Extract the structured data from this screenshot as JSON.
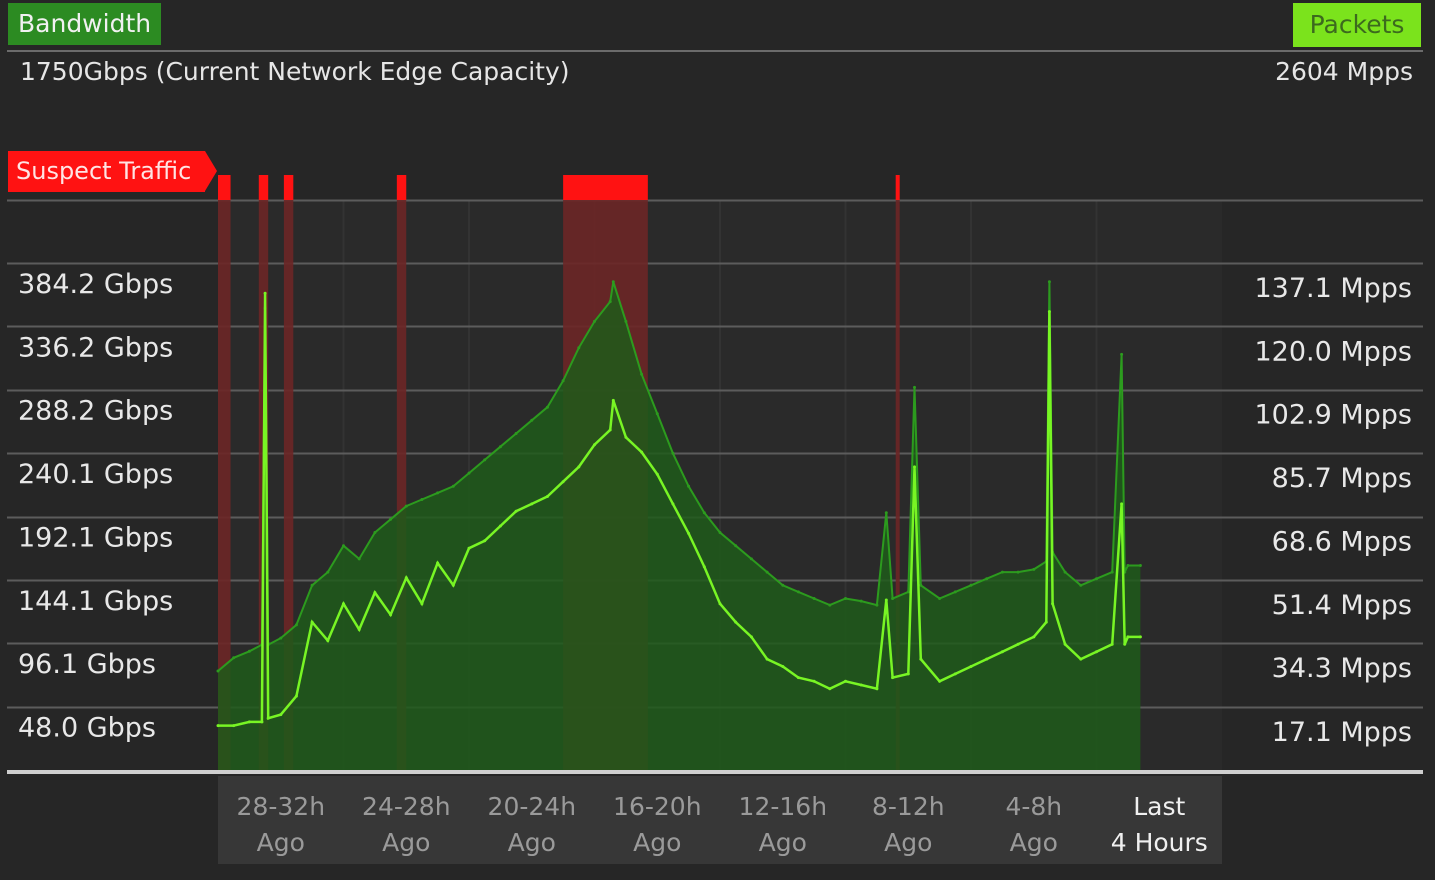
{
  "header": {
    "bandwidth_tab": "Bandwidth",
    "packets_tab": "Packets",
    "capacity_caption": "1750Gbps (Current Network Edge Capacity)",
    "packets_capacity": "2604 Mpps",
    "suspect_label": "Suspect Traffic"
  },
  "colors": {
    "background": "#262626",
    "bandwidth_tag": "#2c8b22",
    "packets_tag": "#7be31c",
    "suspect": "#ff1212",
    "suspect_band": "#6b2626",
    "area_fill": "#1f5a1a",
    "packets_line": "#78f524",
    "bandwidth_line": "#2c9b1e",
    "grid": "#5c5c5c"
  },
  "chart_data": {
    "type": "line",
    "title": "",
    "left_axis": {
      "label": "Bandwidth",
      "ticks": [
        "384.2 Gbps",
        "336.2 Gbps",
        "288.2 Gbps",
        "240.1 Gbps",
        "192.1 Gbps",
        "144.1 Gbps",
        "96.1 Gbps",
        "48.0 Gbps"
      ],
      "tick_values": [
        384.2,
        336.2,
        288.2,
        240.1,
        192.1,
        144.1,
        96.1,
        48.0
      ],
      "unit": "Gbps",
      "ylim": [
        0,
        432
      ]
    },
    "right_axis": {
      "label": "Packets",
      "ticks": [
        "137.1 Mpps",
        "120.0 Mpps",
        "102.9 Mpps",
        "85.7 Mpps",
        "68.6 Mpps",
        "51.4 Mpps",
        "34.3 Mpps",
        "17.1 Mpps"
      ],
      "tick_values": [
        137.1,
        120.0,
        102.9,
        85.7,
        68.6,
        51.4,
        34.3,
        17.1
      ],
      "unit": "Mpps",
      "ylim": [
        0,
        154.2
      ]
    },
    "x_axis": {
      "unit": "hours ago",
      "xlim": [
        32,
        0
      ],
      "categories": [
        {
          "line1": "28-32h",
          "line2": "Ago"
        },
        {
          "line1": "24-28h",
          "line2": "Ago"
        },
        {
          "line1": "20-24h",
          "line2": "Ago"
        },
        {
          "line1": "16-20h",
          "line2": "Ago"
        },
        {
          "line1": "12-16h",
          "line2": "Ago"
        },
        {
          "line1": "8-12h",
          "line2": "Ago"
        },
        {
          "line1": "4-8h",
          "line2": "Ago"
        },
        {
          "line1": "Last",
          "line2": "4 Hours"
        }
      ],
      "data_end_hours_ago": 2.6
    },
    "suspect_windows_hours_ago": [
      [
        32,
        31.6
      ],
      [
        30.7,
        30.4
      ],
      [
        29.9,
        29.6
      ],
      [
        26.3,
        26.0
      ],
      [
        21.0,
        18.3
      ],
      [
        10.4,
        10.3
      ]
    ],
    "series": [
      {
        "name": "Packets",
        "axis": "right",
        "x_hours_ago": [
          32.0,
          31.5,
          31.0,
          30.6,
          30.5,
          30.4,
          30.0,
          29.5,
          29.0,
          28.5,
          28.0,
          27.5,
          27.0,
          26.5,
          26.0,
          25.5,
          25.0,
          24.5,
          24.0,
          23.5,
          23.0,
          22.5,
          22.0,
          21.5,
          21.0,
          20.5,
          20.0,
          19.5,
          19.4,
          19.0,
          18.5,
          18.0,
          17.5,
          17.0,
          16.5,
          16.0,
          15.5,
          15.0,
          14.5,
          14.0,
          13.5,
          13.0,
          12.5,
          12.0,
          11.5,
          11.0,
          10.7,
          10.5,
          10.0,
          9.8,
          9.6,
          9.0,
          8.5,
          8.0,
          7.5,
          7.0,
          6.5,
          6.0,
          5.6,
          5.5,
          5.4,
          5.0,
          4.5,
          4.0,
          3.5,
          3.2,
          3.1,
          3.0,
          2.6
        ],
        "values": [
          12,
          12,
          13,
          13,
          129,
          14,
          15,
          20,
          40,
          35,
          45,
          38,
          48,
          42,
          52,
          45,
          56,
          50,
          60,
          62,
          66,
          70,
          72,
          74,
          78,
          82,
          88,
          92,
          100,
          90,
          86,
          80,
          72,
          64,
          55,
          45,
          40,
          36,
          30,
          28,
          25,
          24,
          22,
          24,
          23,
          22,
          46,
          25,
          26,
          82,
          30,
          24,
          26,
          28,
          30,
          32,
          34,
          36,
          40,
          124,
          45,
          34,
          30,
          32,
          34,
          72,
          34,
          36,
          36
        ]
      },
      {
        "name": "Bandwidth",
        "axis": "left",
        "x_hours_ago": [
          32.0,
          31.5,
          31.0,
          30.6,
          30.5,
          30.4,
          30.0,
          29.5,
          29.0,
          28.5,
          28.0,
          27.5,
          27.0,
          26.5,
          26.0,
          25.5,
          25.0,
          24.5,
          24.0,
          23.5,
          23.0,
          22.5,
          22.0,
          21.5,
          21.0,
          20.5,
          20.0,
          19.5,
          19.4,
          19.0,
          18.5,
          18.0,
          17.5,
          17.0,
          16.5,
          16.0,
          15.5,
          15.0,
          14.5,
          14.0,
          13.5,
          13.0,
          12.5,
          12.0,
          11.5,
          11.0,
          10.7,
          10.5,
          10.0,
          9.8,
          9.6,
          9.0,
          8.5,
          8.0,
          7.5,
          7.0,
          6.5,
          6.0,
          5.6,
          5.5,
          5.4,
          5.0,
          4.5,
          4.0,
          3.5,
          3.2,
          3.1,
          3.0,
          2.6
        ],
        "values": [
          75,
          85,
          90,
          95,
          350,
          95,
          100,
          110,
          140,
          150,
          170,
          160,
          180,
          190,
          200,
          205,
          210,
          215,
          225,
          235,
          245,
          255,
          265,
          275,
          295,
          320,
          340,
          355,
          370,
          340,
          300,
          270,
          240,
          215,
          195,
          180,
          170,
          160,
          150,
          140,
          135,
          130,
          125,
          130,
          128,
          125,
          195,
          130,
          135,
          290,
          140,
          130,
          135,
          140,
          145,
          150,
          150,
          152,
          158,
          370,
          165,
          150,
          140,
          145,
          150,
          315,
          150,
          155,
          155
        ]
      }
    ],
    "grid": true,
    "legend": "none"
  }
}
